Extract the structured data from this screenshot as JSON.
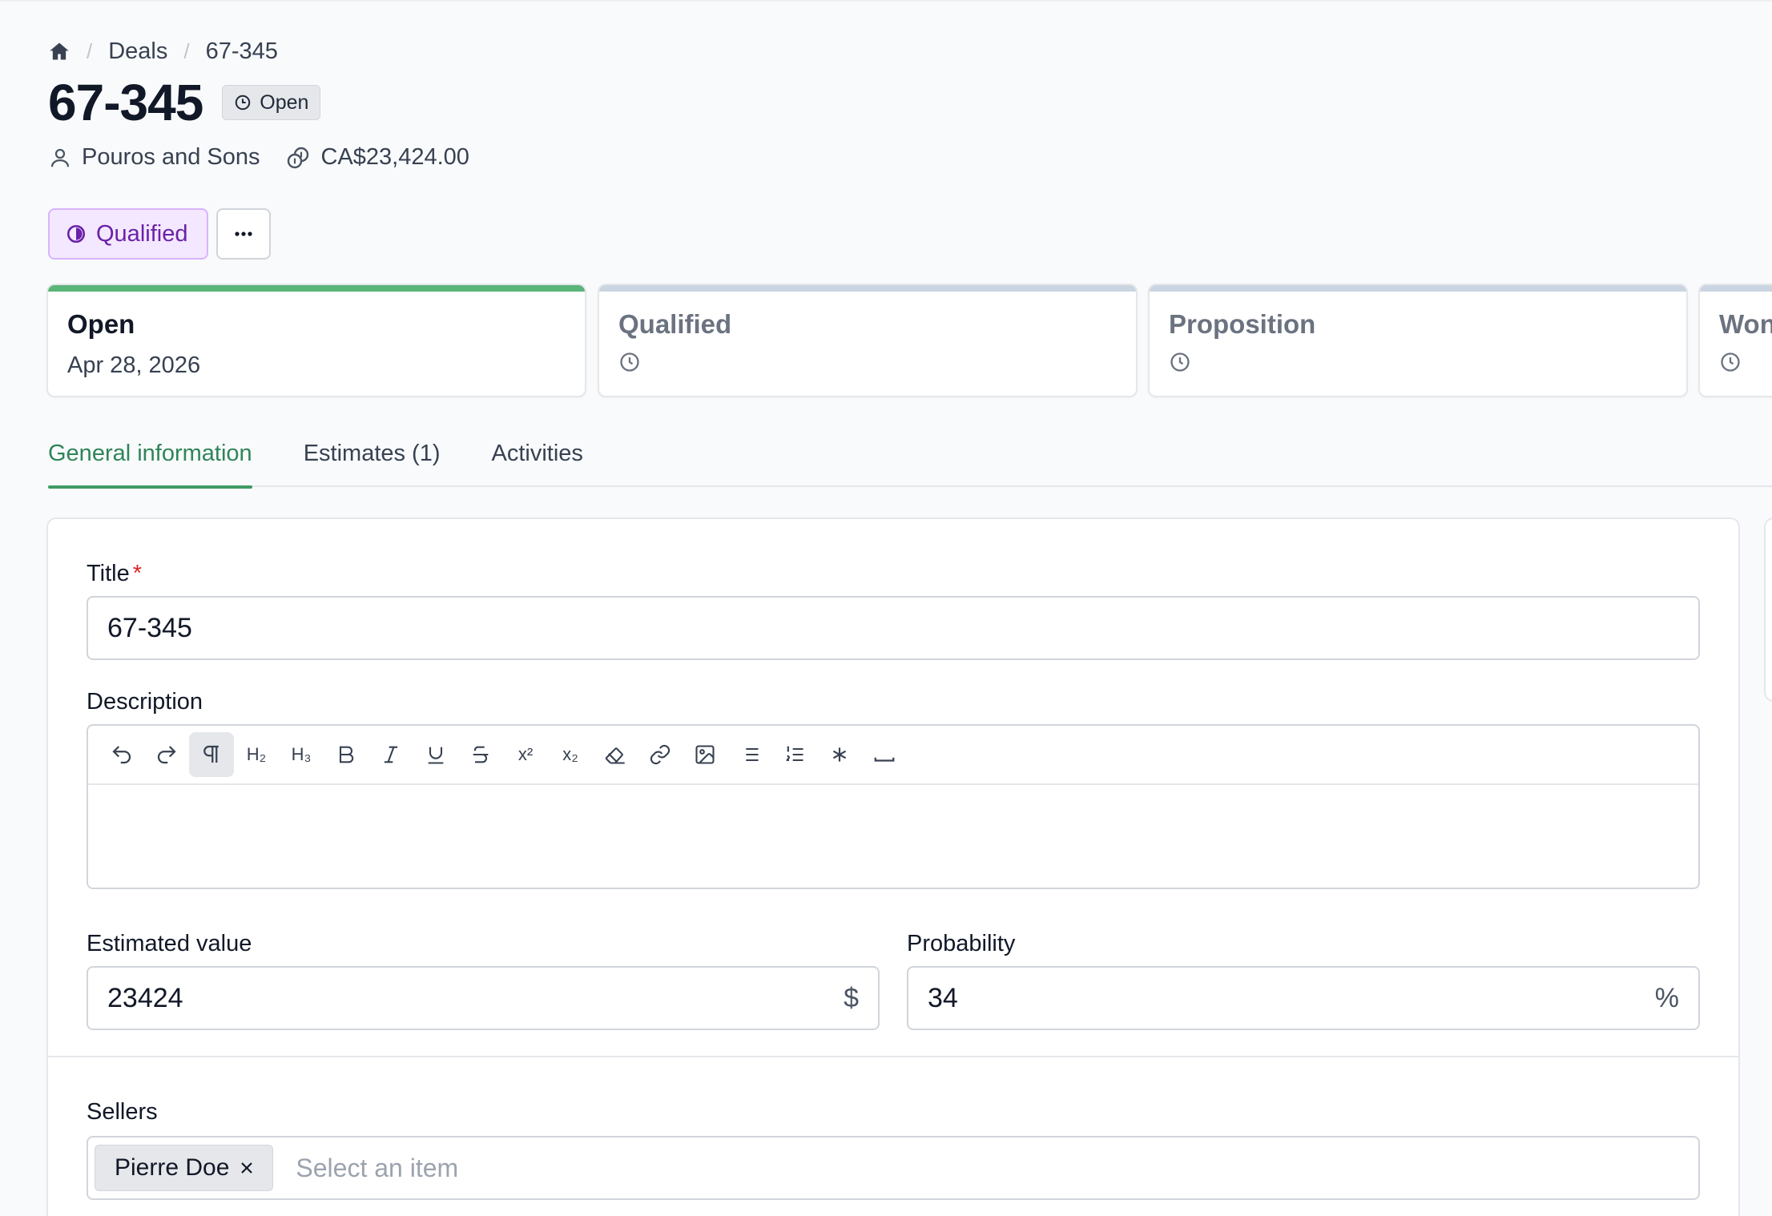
{
  "breadcrumb": {
    "home_icon": "home-icon",
    "section": "Deals",
    "current": "67-345"
  },
  "header": {
    "title": "67-345",
    "status": "Open",
    "company": "Pouros and Sons",
    "amount": "CA$23,424.00"
  },
  "actions": {
    "stage_label": "Qualified",
    "more_icon": "ellipsis-icon"
  },
  "pipeline": [
    {
      "name": "Open",
      "date": "Apr 28, 2026",
      "active": true
    },
    {
      "name": "Qualified",
      "active": false
    },
    {
      "name": "Proposition",
      "active": false
    },
    {
      "name": "Won",
      "active": false
    }
  ],
  "tabs": [
    {
      "label": "General information",
      "active": true
    },
    {
      "label": "Estimates (1)",
      "active": false
    },
    {
      "label": "Activities",
      "active": false
    }
  ],
  "form": {
    "title_label": "Title",
    "title_required_mark": "*",
    "title_value": "67-345",
    "description_label": "Description",
    "toolbar_tools": [
      "undo",
      "redo",
      "paragraph",
      "heading-2",
      "heading-3",
      "bold",
      "italic",
      "underline",
      "strikethrough",
      "superscript",
      "subscript",
      "clear-format",
      "link",
      "image",
      "bullet-list",
      "ordered-list",
      "asterisk",
      "horizontal-rule"
    ],
    "toolbar_text": {
      "h2": "H₂",
      "h3": "H₃",
      "sup": "x²",
      "sub": "x₂"
    },
    "estimated_value_label": "Estimated value",
    "estimated_value": "23424",
    "currency_suffix": "$",
    "probability_label": "Probability",
    "probability_value": "34",
    "probability_suffix": "%",
    "sellers_label": "Sellers",
    "seller_chip": "Pierre Doe",
    "sellers_placeholder": "Select an item"
  },
  "colors": {
    "accent_green": "#3f9b63",
    "qualified_purple": "#6b21a8",
    "required_red": "#dc2626"
  }
}
